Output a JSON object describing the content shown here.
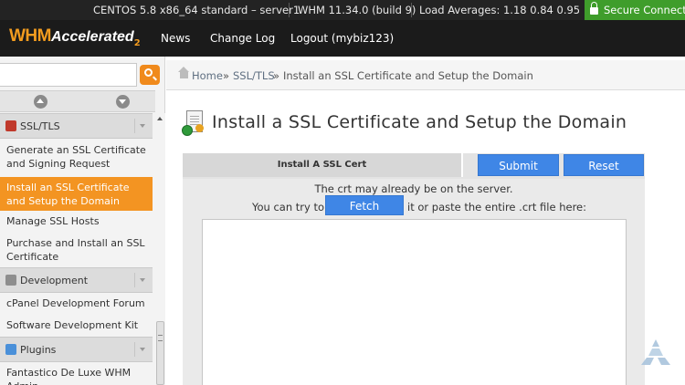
{
  "statusbar": {
    "os": "CENTOS 5.8 x86_64 standard – server1",
    "whm_version": "WHM 11.34.0 (build 9)",
    "load_averages": "Load Averages: 1.18 0.84 0.95",
    "secure_label": "Secure Connectio"
  },
  "header": {
    "logo": {
      "whm": "WHM",
      "accelerated": "Accelerated",
      "sub": "2"
    },
    "nav": [
      "News",
      "Change Log",
      "Logout (mybiz123)"
    ]
  },
  "sidebar": {
    "search": {
      "value": "",
      "placeholder": ""
    },
    "categories": [
      {
        "label": "SSL/TLS",
        "icon": "ssl-icon",
        "color": "#c0392b"
      },
      {
        "label": "Development",
        "icon": "development-icon",
        "color": "#8e8e8e"
      },
      {
        "label": "Plugins",
        "icon": "plugins-icon",
        "color": "#4a90d9"
      }
    ],
    "ssl_items": [
      "Generate an SSL Certificate and Signing Request",
      "Install an SSL Certificate and Setup the Domain",
      "Manage SSL Hosts",
      "Purchase and Install an SSL Certificate"
    ],
    "dev_items": [
      "cPanel Development Forum",
      "Software Development Kit"
    ],
    "plugin_items": [
      "Fantastico De Luxe WHM Admin"
    ],
    "active_item": "Install an SSL Certificate and Setup the Domain"
  },
  "breadcrumb": {
    "home": "Home",
    "sep": "»",
    "section": "SSL/TLS",
    "current": "Install an SSL Certificate and Setup the Domain"
  },
  "main": {
    "title": "Install a SSL Certificate and Setup the Domain",
    "form": {
      "header_label": "Install A SSL Cert",
      "submit_label": "Submit",
      "reset_label": "Reset",
      "line1": "The crt may already be on the server.",
      "line2_prefix": "You can try to",
      "fetch_label": "Fetch",
      "line2_suffix": "it or paste the entire .crt file here:",
      "crt_value": ""
    }
  },
  "colors": {
    "accent_orange": "#f39422",
    "button_blue": "#3f86e6",
    "secure_green": "#3f9d2b",
    "topbar": "#232323"
  }
}
